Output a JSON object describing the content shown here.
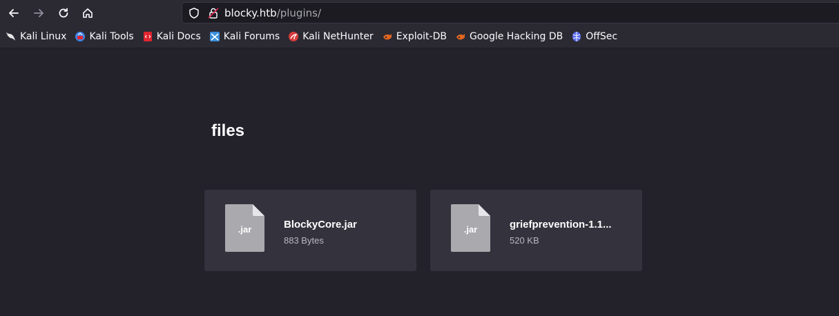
{
  "browser": {
    "url_host": "blocky.htb",
    "url_path": "/plugins/"
  },
  "bookmarks": [
    {
      "label": "Kali Linux",
      "icon": "kali-dragon-icon",
      "color": "#e8e8e8"
    },
    {
      "label": "Kali Tools",
      "icon": "kali-tools-icon",
      "color": "#3f84e5"
    },
    {
      "label": "Kali Docs",
      "icon": "kali-docs-icon",
      "color": "#e0252f"
    },
    {
      "label": "Kali Forums",
      "icon": "kali-forums-icon",
      "color": "#3a8fdc"
    },
    {
      "label": "Kali NetHunter",
      "icon": "nethunter-icon",
      "color": "#d83a3a"
    },
    {
      "label": "Exploit-DB",
      "icon": "exploit-db-icon",
      "color": "#e2661f"
    },
    {
      "label": "Google Hacking DB",
      "icon": "ghdb-icon",
      "color": "#e2661f"
    },
    {
      "label": "OffSec",
      "icon": "offsec-icon",
      "color": "#5b6cf2"
    }
  ],
  "page": {
    "heading": "files",
    "files": [
      {
        "name": "BlockyCore.jar",
        "size": "883 Bytes",
        "ext": ".jar",
        "icon": "jar-file-icon"
      },
      {
        "name": "griefprevention-1.1...",
        "size": "520 KB",
        "ext": ".jar",
        "icon": "jar-file-icon"
      }
    ]
  },
  "colors": {
    "page_bg": "#23222b",
    "card_bg": "#34333d",
    "toolbar_bg": "#2b2a33",
    "file_icon": "#a9a9ae"
  }
}
